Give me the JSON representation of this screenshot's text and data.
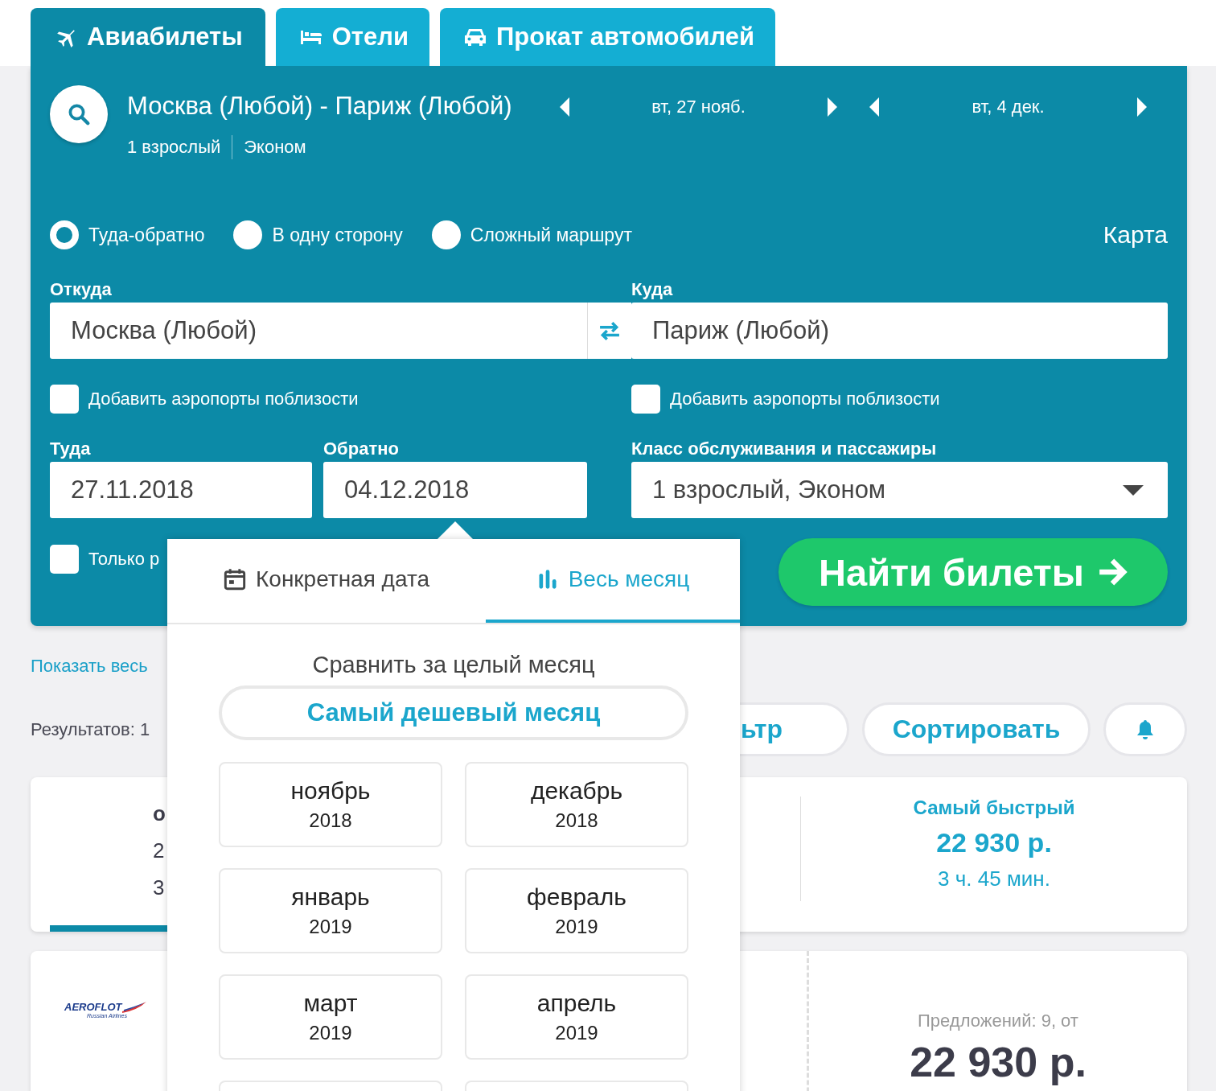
{
  "tabs": [
    {
      "label": "Авиабилеты",
      "kind": "flights",
      "selected": true
    },
    {
      "label": "Отели",
      "kind": "hotels",
      "selected": false
    },
    {
      "label": "Прокат автомобилей",
      "kind": "cars",
      "selected": false
    }
  ],
  "summary": {
    "route": "Москва (Любой) - Париж (Любой)",
    "dates": [
      "вт, 27 нояб.",
      "вт, 4 дек."
    ],
    "passengers": "1 взрослый",
    "cabin": "Эконом"
  },
  "trip_types": [
    {
      "label": "Туда-обратно",
      "selected": true
    },
    {
      "label": "В одну сторону",
      "selected": false
    },
    {
      "label": "Сложный маршрут",
      "selected": false
    }
  ],
  "map_link": "Карта",
  "from": {
    "label": "Откуда",
    "value": "Москва (Любой)",
    "nearby": {
      "label": "Добавить аэропорты поблизости",
      "checked": false
    }
  },
  "to": {
    "label": "Куда",
    "value": "Париж (Любой)",
    "nearby": {
      "label": "Добавить аэропорты поблизости",
      "checked": false
    }
  },
  "depart": {
    "label": "Туда",
    "value": "27.11.2018"
  },
  "return": {
    "label": "Обратно",
    "value": "04.12.2018"
  },
  "cabin": {
    "label": "Класс обслуживания и пассажиры",
    "value": "1 взрослый, Эконом"
  },
  "only_option": {
    "label": "Только р",
    "checked": false
  },
  "search_button": "Найти билеты",
  "show_all_link": "Показать весь",
  "results_count": "Результатов: 1",
  "toolbar": {
    "filter_button": "ьтр",
    "sort_button": "Сортировать"
  },
  "summary_card": {
    "column_1": [
      "о",
      "2",
      "3"
    ],
    "fastest": {
      "title": "Самый быстрый",
      "price": "22 930 р.",
      "duration": "3 ч. 45 мин."
    }
  },
  "offer_card": {
    "airline": {
      "name": "AEROFLOT",
      "subtitle": "Russian Airlines"
    },
    "offers": "Предложений: 9, от",
    "price": "22 930 р."
  },
  "date_popover": {
    "tabs": [
      {
        "label": "Конкретная дата",
        "kind": "date",
        "selected": false
      },
      {
        "label": "Весь месяц",
        "kind": "month",
        "selected": true
      }
    ],
    "heading": "Сравнить за целый месяц",
    "cheapest_button": "Самый дешевый месяц",
    "months": [
      {
        "month": "ноябрь",
        "year": "2018"
      },
      {
        "month": "декабрь",
        "year": "2018"
      },
      {
        "month": "январь",
        "year": "2019"
      },
      {
        "month": "февраль",
        "year": "2019"
      },
      {
        "month": "март",
        "year": "2019"
      },
      {
        "month": "апрель",
        "year": "2019"
      }
    ]
  }
}
